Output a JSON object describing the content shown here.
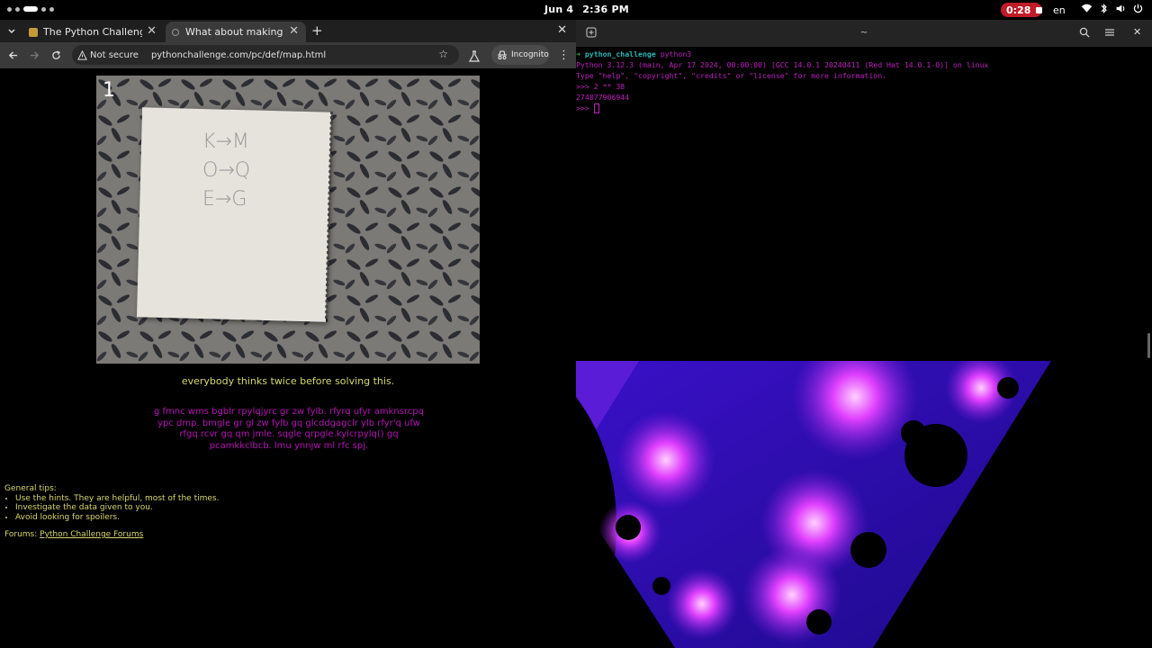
{
  "topbar": {
    "date": "Jun 4",
    "time": "2:36 PM",
    "recording": "0:28",
    "language": "en"
  },
  "browser": {
    "tabs": [
      {
        "title": "The Python Challenge"
      },
      {
        "title": "What about making trans"
      }
    ],
    "address": {
      "security_label": "Not secure",
      "url": "pythonchallenge.com/pc/def/map.html"
    },
    "incognito_label": "Incognito"
  },
  "page": {
    "level_number": "1",
    "handwriting": [
      "K→M",
      "O→Q",
      "E→G"
    ],
    "caption": "everybody thinks twice before solving this.",
    "cipher": "g fmnc wms bgblr rpylqjyrc gr zw fylb. rfyrq ufyr amknsrcpq ypc dmp. bmgle gr gl zw fylb gq glcddgagclr ylb rfyr'q ufw rfgq rcvr gq qm jmle. sqgle qrpgle.kyicrpylq() gq pcamkkclbcb. lmu ynnjw ml rfc spj.",
    "tips_heading": "General tips:",
    "tips": [
      "Use the hints. They are helpful, most of the times.",
      "Investigate the data given to you.",
      "Avoid looking for spoilers."
    ],
    "forums_label": "Forums:",
    "forums_link": "Python Challenge Forums"
  },
  "terminal": {
    "title": "~",
    "prompt_arrow": "➜",
    "cwd": "python_challenge",
    "command": "python3",
    "lines": [
      "Python 3.12.3 (main, Apr 17 2024, 00:00:00) [GCC 14.0.1 20240411 (Red Hat 14.0.1-0)] on linux",
      "Type \"help\", \"copyright\", \"credits\" or \"license\" for more information.",
      ">>> 2 ** 38",
      "274877906944",
      ">>> "
    ]
  },
  "colors": {
    "caption_yellow": "#d7d76e",
    "cipher_magenta": "#b514b5",
    "terminal_magenta": "#c01ec0",
    "record_red": "#c01c28"
  }
}
